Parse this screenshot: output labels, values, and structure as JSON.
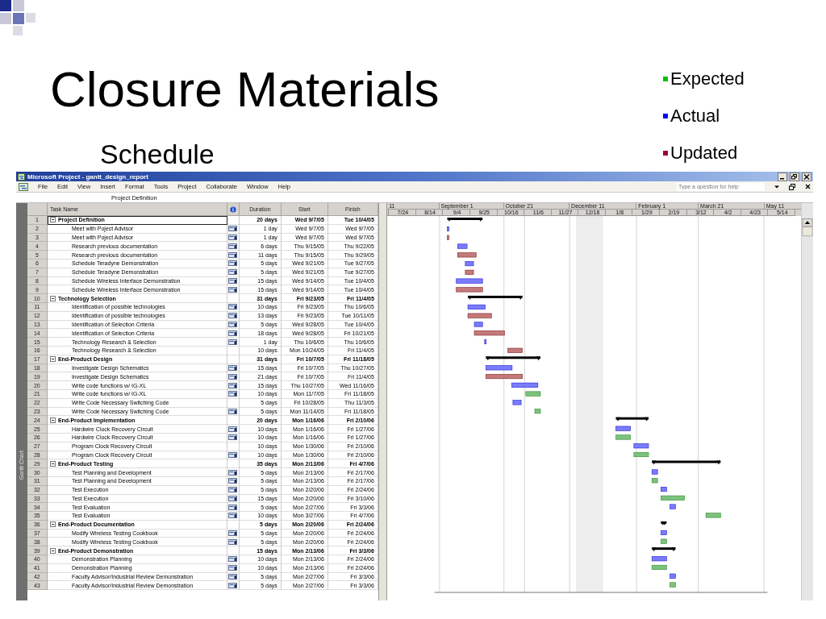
{
  "slide": {
    "title": "Closure Materials",
    "subtitle": "Schedule",
    "legend": [
      {
        "label": "Expected",
        "color": "#00c000"
      },
      {
        "label": "Actual",
        "color": "#0000ff"
      },
      {
        "label": "Updated",
        "color": "#a00030"
      }
    ]
  },
  "window": {
    "title": "Microsoft Project - gantt_design_report",
    "menus": [
      "File",
      "Edit",
      "View",
      "Insert",
      "Format",
      "Tools",
      "Project",
      "Collaborate",
      "Window",
      "Help"
    ],
    "help_field": {
      "placeholder": "Type a question for help"
    },
    "entry_bar": {
      "value": "Project Definition"
    },
    "view_bar": {
      "label": "Gantt Chart"
    }
  },
  "table": {
    "columns": [
      "Task Name",
      "Duration",
      "Start",
      "Finish"
    ],
    "rows": [
      {
        "id": "1",
        "name": "Project Definition",
        "kind": "summary",
        "indicator": false,
        "duration": "20 days",
        "start": "Wed 9/7/05",
        "finish": "Tue 10/4/05",
        "selected": true
      },
      {
        "id": "2",
        "name": "Meet with Poject Advisor",
        "kind": "actual",
        "indicator": true,
        "duration": "1 day",
        "start": "Wed 9/7/05",
        "finish": "Wed 9/7/05",
        "selected": false
      },
      {
        "id": "3",
        "name": "Meet with Poject Advisor",
        "kind": "updated",
        "indicator": true,
        "duration": "1 day",
        "start": "Wed 9/7/05",
        "finish": "Wed 9/7/05",
        "selected": false
      },
      {
        "id": "4",
        "name": "Research previous documentation",
        "kind": "actual",
        "indicator": true,
        "duration": "6 days",
        "start": "Thu 9/15/05",
        "finish": "Thu 9/22/05",
        "selected": false
      },
      {
        "id": "5",
        "name": "Research previous documentation",
        "kind": "updated",
        "indicator": true,
        "duration": "11 days",
        "start": "Thu 9/15/05",
        "finish": "Thu 9/29/05",
        "selected": false
      },
      {
        "id": "6",
        "name": "Schedule Teradyne Demonstration",
        "kind": "actual",
        "indicator": true,
        "duration": "5 days",
        "start": "Wed 9/21/05",
        "finish": "Tue 9/27/05",
        "selected": false
      },
      {
        "id": "7",
        "name": "Schedule Teradyne Demonstration",
        "kind": "updated",
        "indicator": true,
        "duration": "5 days",
        "start": "Wed 9/21/05",
        "finish": "Tue 9/27/05",
        "selected": false
      },
      {
        "id": "8",
        "name": "Schedule Wireless Interface Demonstration",
        "kind": "actual",
        "indicator": true,
        "duration": "15 days",
        "start": "Wed 9/14/05",
        "finish": "Tue 10/4/05",
        "selected": false
      },
      {
        "id": "9",
        "name": "Schedule Wireless Interface Demonstration",
        "kind": "updated",
        "indicator": true,
        "duration": "15 days",
        "start": "Wed 9/14/05",
        "finish": "Tue 10/4/05",
        "selected": false
      },
      {
        "id": "10",
        "name": "Technology Selection",
        "kind": "summary",
        "indicator": false,
        "duration": "31 days",
        "start": "Fri 9/23/05",
        "finish": "Fri 11/4/05",
        "selected": false
      },
      {
        "id": "11",
        "name": "Identification of possible technologies",
        "kind": "actual",
        "indicator": true,
        "duration": "10 days",
        "start": "Fri 9/23/05",
        "finish": "Thu 10/6/05",
        "selected": false
      },
      {
        "id": "12",
        "name": "Identification of possible technologies",
        "kind": "updated",
        "indicator": true,
        "duration": "13 days",
        "start": "Fri 9/23/05",
        "finish": "Tue 10/11/05",
        "selected": false
      },
      {
        "id": "13",
        "name": "Identification of Selection Criteria",
        "kind": "actual",
        "indicator": true,
        "duration": "5 days",
        "start": "Wed 9/28/05",
        "finish": "Tue 10/4/05",
        "selected": false
      },
      {
        "id": "14",
        "name": "Identification of Selection Criteria",
        "kind": "updated",
        "indicator": true,
        "duration": "18 days",
        "start": "Wed 9/28/05",
        "finish": "Fri 10/21/05",
        "selected": false
      },
      {
        "id": "15",
        "name": "Technology Research & Selection",
        "kind": "actual",
        "indicator": true,
        "duration": "1 day",
        "start": "Thu 10/6/05",
        "finish": "Thu 10/6/05",
        "selected": false
      },
      {
        "id": "16",
        "name": "Technology Research & Selection",
        "kind": "updated",
        "indicator": false,
        "duration": "10 days",
        "start": "Mon 10/24/05",
        "finish": "Fri 11/4/05",
        "selected": false
      },
      {
        "id": "17",
        "name": "End-Product Design",
        "kind": "summary",
        "indicator": false,
        "duration": "31 days",
        "start": "Fri 10/7/05",
        "finish": "Fri 11/18/05",
        "selected": false
      },
      {
        "id": "18",
        "name": "Investigate Design Schematics",
        "kind": "actual",
        "indicator": true,
        "duration": "15 days",
        "start": "Fri 10/7/05",
        "finish": "Thu 10/27/05",
        "selected": false
      },
      {
        "id": "19",
        "name": "Investigate Design Schematics",
        "kind": "updated",
        "indicator": true,
        "duration": "21 days",
        "start": "Fri 10/7/05",
        "finish": "Fri 11/4/05",
        "selected": false
      },
      {
        "id": "20",
        "name": "Write code functions w/ IG-XL",
        "kind": "actual",
        "indicator": true,
        "duration": "15 days",
        "start": "Thu 10/27/05",
        "finish": "Wed 11/16/05",
        "selected": false
      },
      {
        "id": "21",
        "name": "Write code functions w/ IG-XL",
        "kind": "expected",
        "indicator": true,
        "duration": "10 days",
        "start": "Mon 11/7/05",
        "finish": "Fri 11/18/05",
        "selected": false
      },
      {
        "id": "22",
        "name": "Write Code Necessary Switching Code",
        "kind": "actual",
        "indicator": false,
        "duration": "5 days",
        "start": "Fri 10/28/05",
        "finish": "Thu 11/3/05",
        "selected": false
      },
      {
        "id": "23",
        "name": "Write Code Necessary Switching Code",
        "kind": "expected",
        "indicator": true,
        "duration": "5 days",
        "start": "Mon 11/14/05",
        "finish": "Fri 11/18/05",
        "selected": false
      },
      {
        "id": "24",
        "name": "End-Product Implementation",
        "kind": "summary",
        "indicator": false,
        "duration": "20 days",
        "start": "Mon 1/16/06",
        "finish": "Fri 2/10/06",
        "selected": false
      },
      {
        "id": "25",
        "name": "Hardwire Clock Recovery Circuit",
        "kind": "actual",
        "indicator": true,
        "duration": "10 days",
        "start": "Mon 1/16/06",
        "finish": "Fri 1/27/06",
        "selected": false
      },
      {
        "id": "26",
        "name": "Hardwire Clock Recovery Circuit",
        "kind": "expected",
        "indicator": true,
        "duration": "10 days",
        "start": "Mon 1/16/06",
        "finish": "Fri 1/27/06",
        "selected": false
      },
      {
        "id": "27",
        "name": "Program Clock Recovery Circuit",
        "kind": "actual",
        "indicator": false,
        "duration": "10 days",
        "start": "Mon 1/30/06",
        "finish": "Fri 2/10/06",
        "selected": false
      },
      {
        "id": "28",
        "name": "Program Clock Recovery Circuit",
        "kind": "expected",
        "indicator": true,
        "duration": "10 days",
        "start": "Mon 1/30/06",
        "finish": "Fri 2/10/06",
        "selected": false
      },
      {
        "id": "29",
        "name": "End-Product Testing",
        "kind": "summary",
        "indicator": false,
        "duration": "35 days",
        "start": "Mon 2/13/06",
        "finish": "Fri 4/7/06",
        "selected": false
      },
      {
        "id": "30",
        "name": "Test Planning and Development",
        "kind": "actual",
        "indicator": true,
        "duration": "5 days",
        "start": "Mon 2/13/06",
        "finish": "Fri 2/17/06",
        "selected": false
      },
      {
        "id": "31",
        "name": "Test Planning and Development",
        "kind": "expected",
        "indicator": true,
        "duration": "5 days",
        "start": "Mon 2/13/06",
        "finish": "Fri 2/17/06",
        "selected": false
      },
      {
        "id": "32",
        "name": "Test Execution",
        "kind": "actual",
        "indicator": true,
        "duration": "5 days",
        "start": "Mon 2/20/06",
        "finish": "Fri 2/24/06",
        "selected": false
      },
      {
        "id": "33",
        "name": "Test Execution",
        "kind": "expected",
        "indicator": true,
        "duration": "15 days",
        "start": "Mon 2/20/06",
        "finish": "Fri 3/10/06",
        "selected": false
      },
      {
        "id": "34",
        "name": "Test Evaluation",
        "kind": "actual",
        "indicator": true,
        "duration": "5 days",
        "start": "Mon 2/27/06",
        "finish": "Fri 3/3/06",
        "selected": false
      },
      {
        "id": "35",
        "name": "Test Evaluation",
        "kind": "expected",
        "indicator": true,
        "duration": "10 days",
        "start": "Mon 3/27/06",
        "finish": "Fri 4/7/06",
        "selected": false
      },
      {
        "id": "36",
        "name": "End-Product Documentation",
        "kind": "summary",
        "indicator": false,
        "duration": "5 days",
        "start": "Mon 2/20/06",
        "finish": "Fri 2/24/06",
        "selected": false
      },
      {
        "id": "37",
        "name": "Modify Wireless Testing Cookbook",
        "kind": "actual",
        "indicator": true,
        "duration": "5 days",
        "start": "Mon 2/20/06",
        "finish": "Fri 2/24/06",
        "selected": false
      },
      {
        "id": "38",
        "name": "Modify Wireless Testing Cookbook",
        "kind": "expected",
        "indicator": true,
        "duration": "5 days",
        "start": "Mon 2/20/06",
        "finish": "Fri 2/24/06",
        "selected": false
      },
      {
        "id": "39",
        "name": "End-Product Demonstration",
        "kind": "summary",
        "indicator": false,
        "duration": "15 days",
        "start": "Mon 2/13/06",
        "finish": "Fri 3/3/06",
        "selected": false
      },
      {
        "id": "40",
        "name": "Demonstration Planning",
        "kind": "actual",
        "indicator": true,
        "duration": "10 days",
        "start": "Mon 2/13/06",
        "finish": "Fri 2/24/06",
        "selected": false
      },
      {
        "id": "41",
        "name": "Demonstration Planning",
        "kind": "expected",
        "indicator": true,
        "duration": "10 days",
        "start": "Mon 2/13/06",
        "finish": "Fri 2/24/06",
        "selected": false
      },
      {
        "id": "42",
        "name": "Faculty Advisor/Industrial Review Demonstration",
        "kind": "actual",
        "indicator": true,
        "duration": "5 days",
        "start": "Mon 2/27/06",
        "finish": "Fri 3/3/06",
        "selected": false
      },
      {
        "id": "43",
        "name": "Faculty Advisor/Industrial Review Demonstration",
        "kind": "expected",
        "indicator": true,
        "duration": "5 days",
        "start": "Mon 2/27/06",
        "finish": "Fri 3/3/06",
        "selected": false
      }
    ]
  },
  "timescale": {
    "major": [
      "11",
      "September 1",
      "October 21",
      "December 11",
      "February 1",
      "March 21",
      "May 11"
    ],
    "minor": [
      "7/24",
      "8/14",
      "9/4",
      "9/25",
      "10/16",
      "11/6",
      "11/27",
      "12/18",
      "1/8",
      "1/29",
      "2/19",
      "3/12",
      "4/2",
      "4/23",
      "5/14"
    ]
  }
}
